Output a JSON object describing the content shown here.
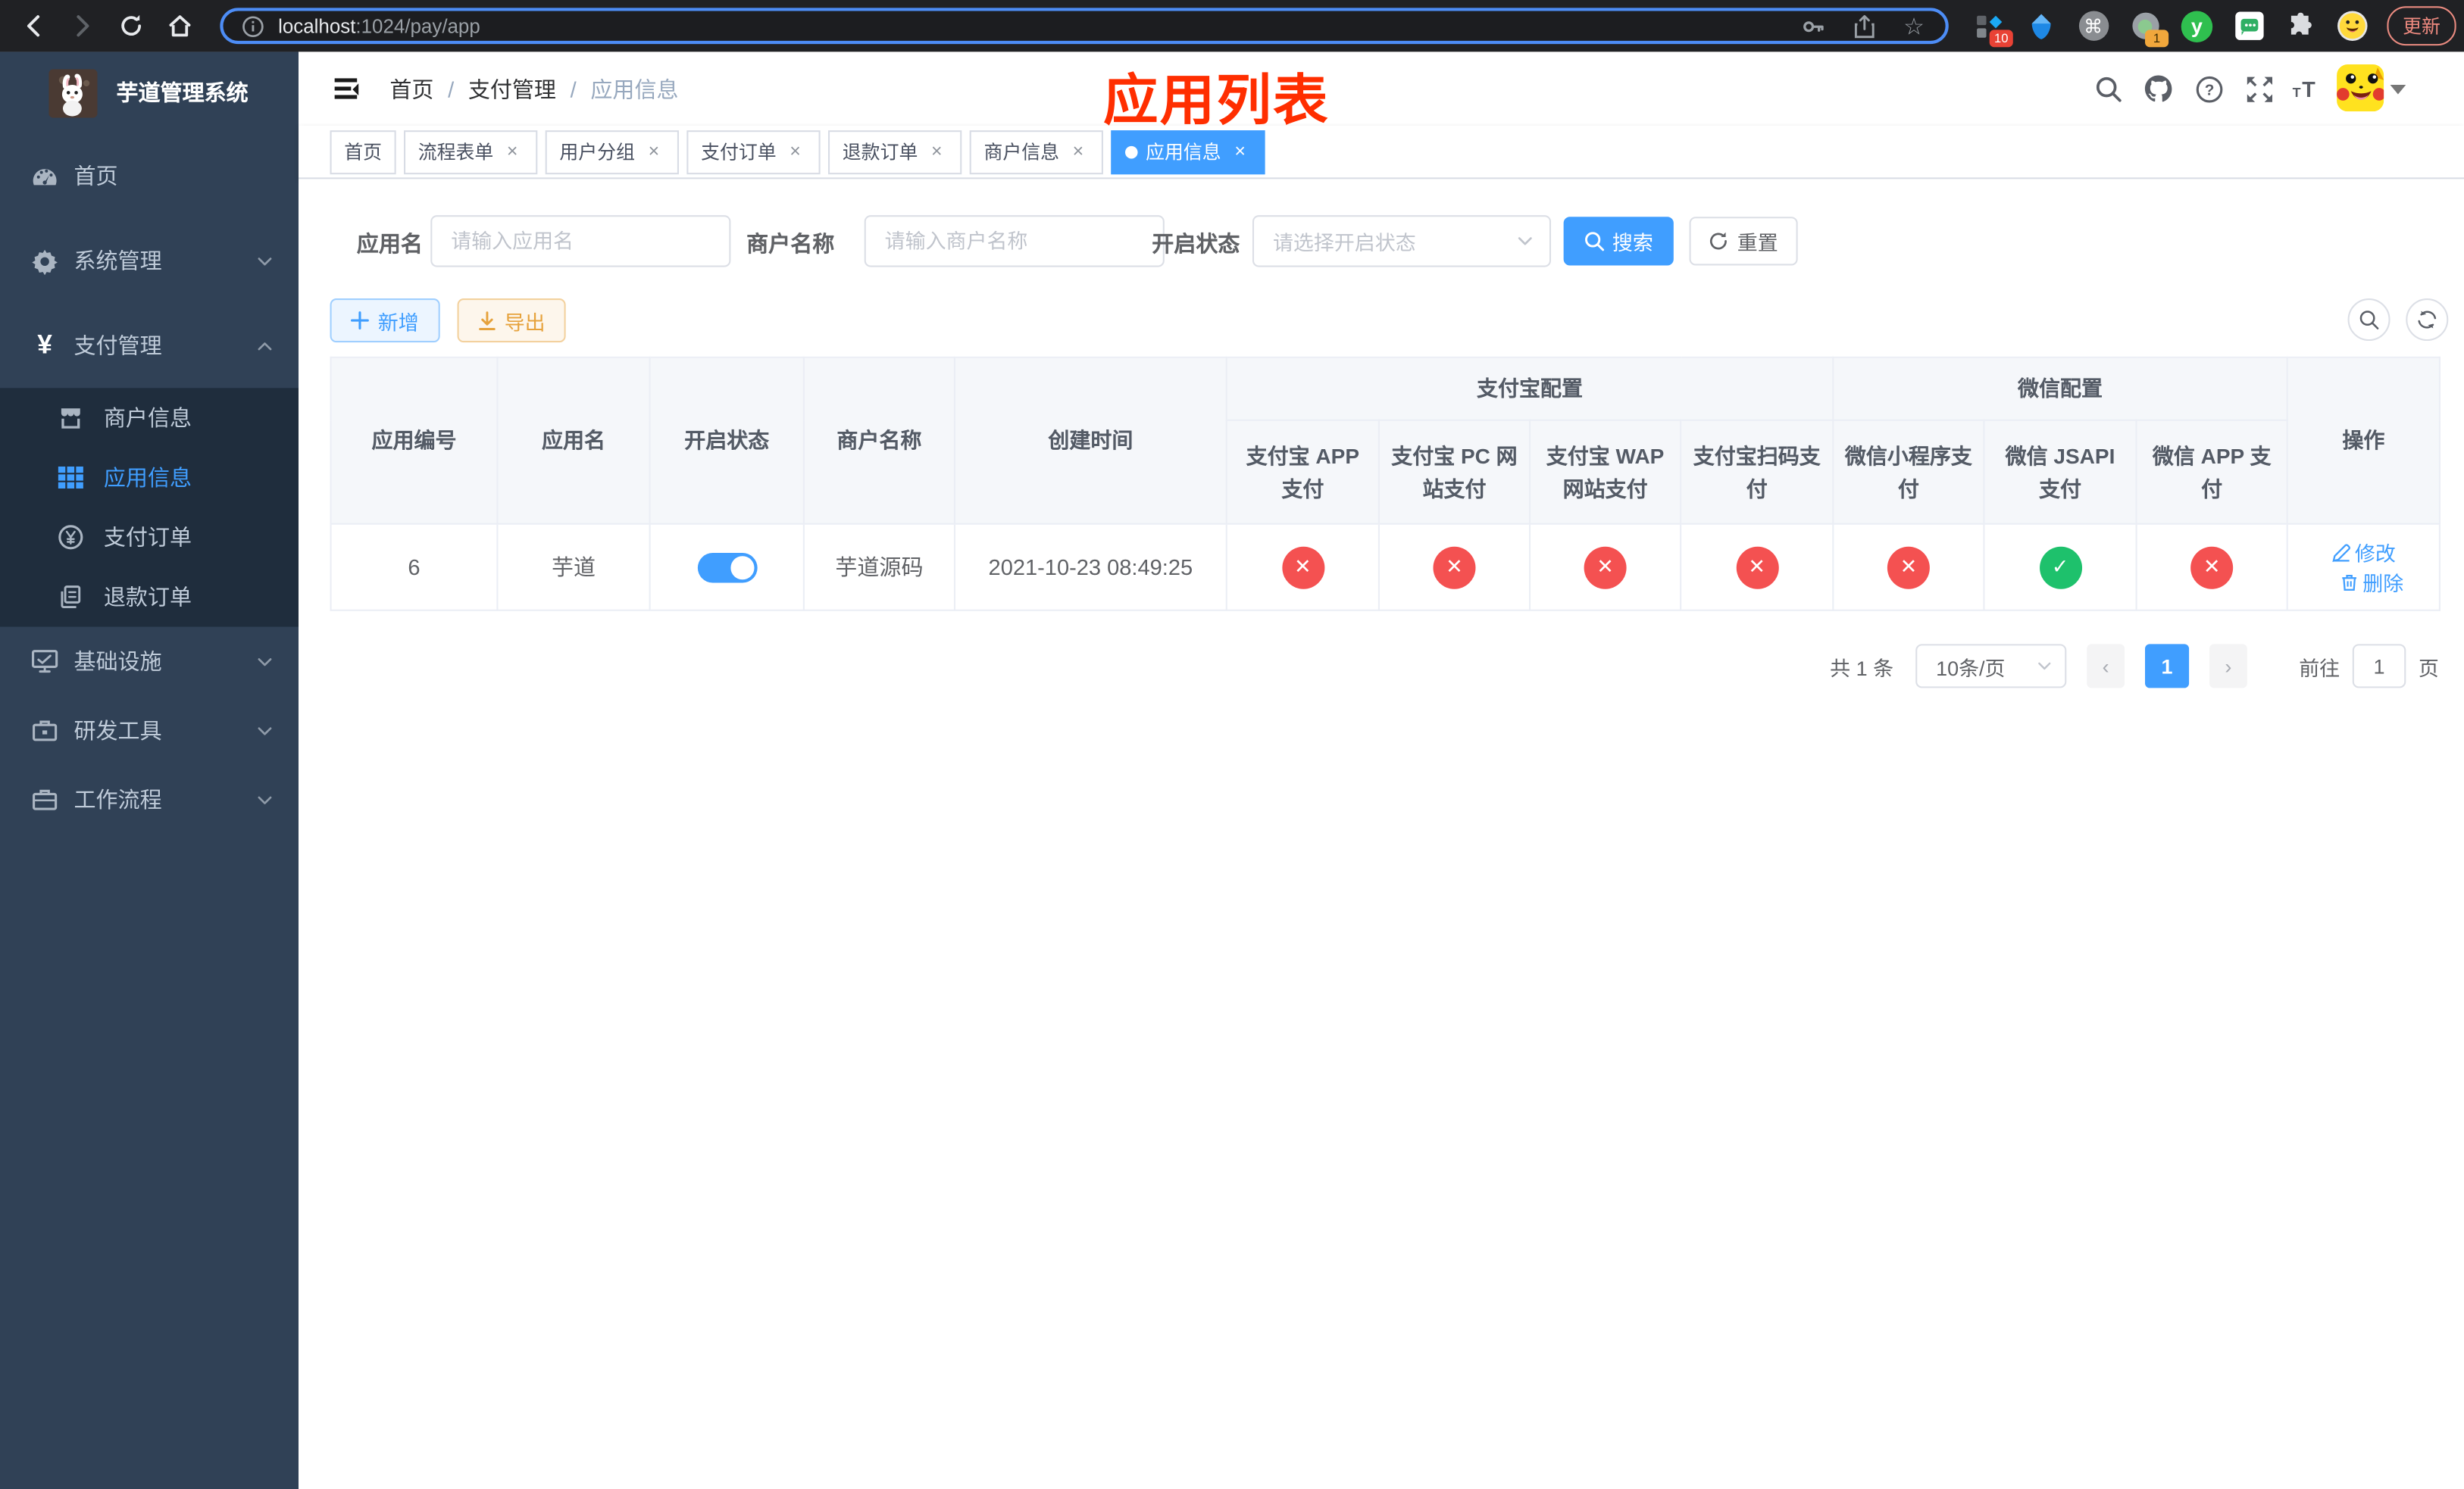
{
  "browser": {
    "url_host": "localhost",
    "url_path": ":1024/pay/app",
    "update_label": "更新",
    "ext_badge_blocks": "10",
    "ext_badge_tag": "1",
    "ext_y_letter": "y",
    "cmd_glyph": "⌘",
    "star_glyph": "☆",
    "menu_dots": "⋮"
  },
  "sidebar": {
    "title": "芋道管理系统",
    "items": [
      {
        "label": "首页"
      },
      {
        "label": "系统管理"
      },
      {
        "label": "支付管理",
        "expanded": true,
        "children": [
          {
            "label": "商户信息"
          },
          {
            "label": "应用信息",
            "active": true
          },
          {
            "label": "支付订单"
          },
          {
            "label": "退款订单"
          }
        ]
      },
      {
        "label": "基础设施"
      },
      {
        "label": "研发工具"
      },
      {
        "label": "工作流程"
      }
    ]
  },
  "header": {
    "breadcrumb": [
      "首页",
      "支付管理",
      "应用信息"
    ],
    "separator": "/",
    "annotation": "应用列表"
  },
  "tags": {
    "items": [
      {
        "label": "首页",
        "closable": false
      },
      {
        "label": "流程表单",
        "closable": true
      },
      {
        "label": "用户分组",
        "closable": true
      },
      {
        "label": "支付订单",
        "closable": true
      },
      {
        "label": "退款订单",
        "closable": true
      },
      {
        "label": "商户信息",
        "closable": true
      },
      {
        "label": "应用信息",
        "closable": true,
        "active": true
      }
    ],
    "close_glyph": "×"
  },
  "filters": {
    "app_name_label": "应用名",
    "app_name_placeholder": "请输入应用名",
    "merchant_label": "商户名称",
    "merchant_placeholder": "请输入商户名称",
    "status_label": "开启状态",
    "status_placeholder": "请选择开启状态",
    "search_label": "搜索",
    "reset_label": "重置"
  },
  "toolbar": {
    "add_label": "新增",
    "export_label": "导出"
  },
  "table": {
    "group_headers": [
      "支付宝配置",
      "微信配置"
    ],
    "columns": [
      "应用编号",
      "应用名",
      "开启状态",
      "商户名称",
      "创建时间",
      "支付宝 APP 支付",
      "支付宝 PC 网站支付",
      "支付宝 WAP 网站支付",
      "支付宝扫码支付",
      "微信小程序支付",
      "微信 JSAPI 支付",
      "微信 APP 支付",
      "操作"
    ],
    "rows": [
      {
        "id": "6",
        "name": "芋道",
        "enabled": true,
        "merchant": "芋道源码",
        "created_at": "2021-10-23 08:49:25",
        "channel_enabled": [
          false,
          false,
          false,
          false,
          false,
          true,
          false
        ],
        "status_glyphs": [
          "✕",
          "✕",
          "✕",
          "✕",
          "✕",
          "✓",
          "✕"
        ],
        "edit_label": "修改",
        "delete_label": "删除"
      }
    ]
  },
  "pagination": {
    "total_label": "共 1 条",
    "page_size_label": "10条/页",
    "prev_glyph": "‹",
    "current_page": "1",
    "next_glyph": "›",
    "goto_label": "前往",
    "goto_value": "1",
    "page_unit": "页"
  }
}
